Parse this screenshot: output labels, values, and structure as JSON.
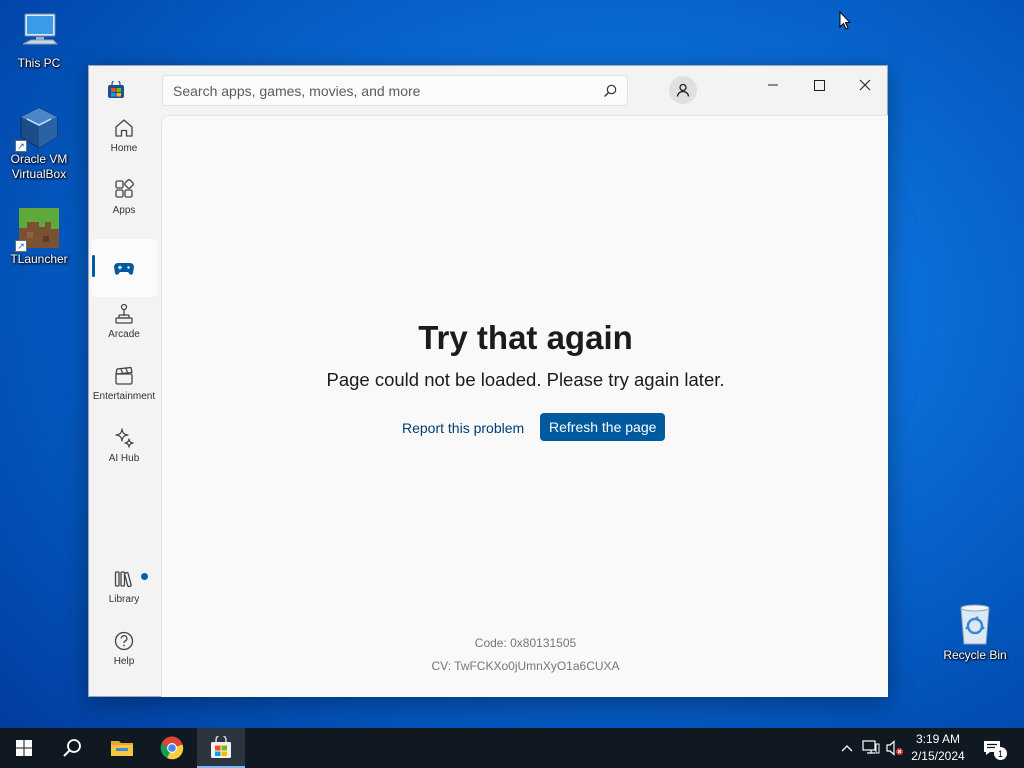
{
  "desktop": {
    "icons": [
      {
        "label": "This PC"
      },
      {
        "label": "Oracle VM VirtualBox"
      },
      {
        "label": "TLauncher"
      },
      {
        "label": "Recycle Bin"
      }
    ]
  },
  "store": {
    "search": {
      "placeholder": "Search apps, games, movies, and more"
    },
    "nav": [
      {
        "label": "Home",
        "icon": "home-icon"
      },
      {
        "label": "Apps",
        "icon": "apps-icon"
      },
      {
        "label": "",
        "icon": "gamepad-icon",
        "active": true
      },
      {
        "label": "Arcade",
        "icon": "joystick-icon"
      },
      {
        "label": "Entertainment",
        "icon": "clapperboard-icon"
      },
      {
        "label": "AI Hub",
        "icon": "sparkle-icon"
      },
      {
        "label": "Library",
        "icon": "library-icon",
        "badge": true
      },
      {
        "label": "Help",
        "icon": "help-icon"
      }
    ],
    "error": {
      "title": "Try that again",
      "subtitle": "Page could not be loaded. Please try again later.",
      "report_label": "Report this problem",
      "refresh_label": "Refresh the page",
      "code": "Code: 0x80131505",
      "cv": "CV: TwFCKXo0jUmnXyO1a6CUXA"
    },
    "colors": {
      "accent": "#005a9e",
      "content_bg": "#f9f9f9",
      "sidebar_bg": "#f3f3f3"
    }
  },
  "taskbar": {
    "apps": [
      "start-icon",
      "search-icon",
      "file-explorer-icon",
      "chrome-icon",
      "microsoft-store-icon"
    ],
    "clock": {
      "time": "3:19 AM",
      "date": "2/15/2024"
    },
    "notification_count": "1"
  }
}
